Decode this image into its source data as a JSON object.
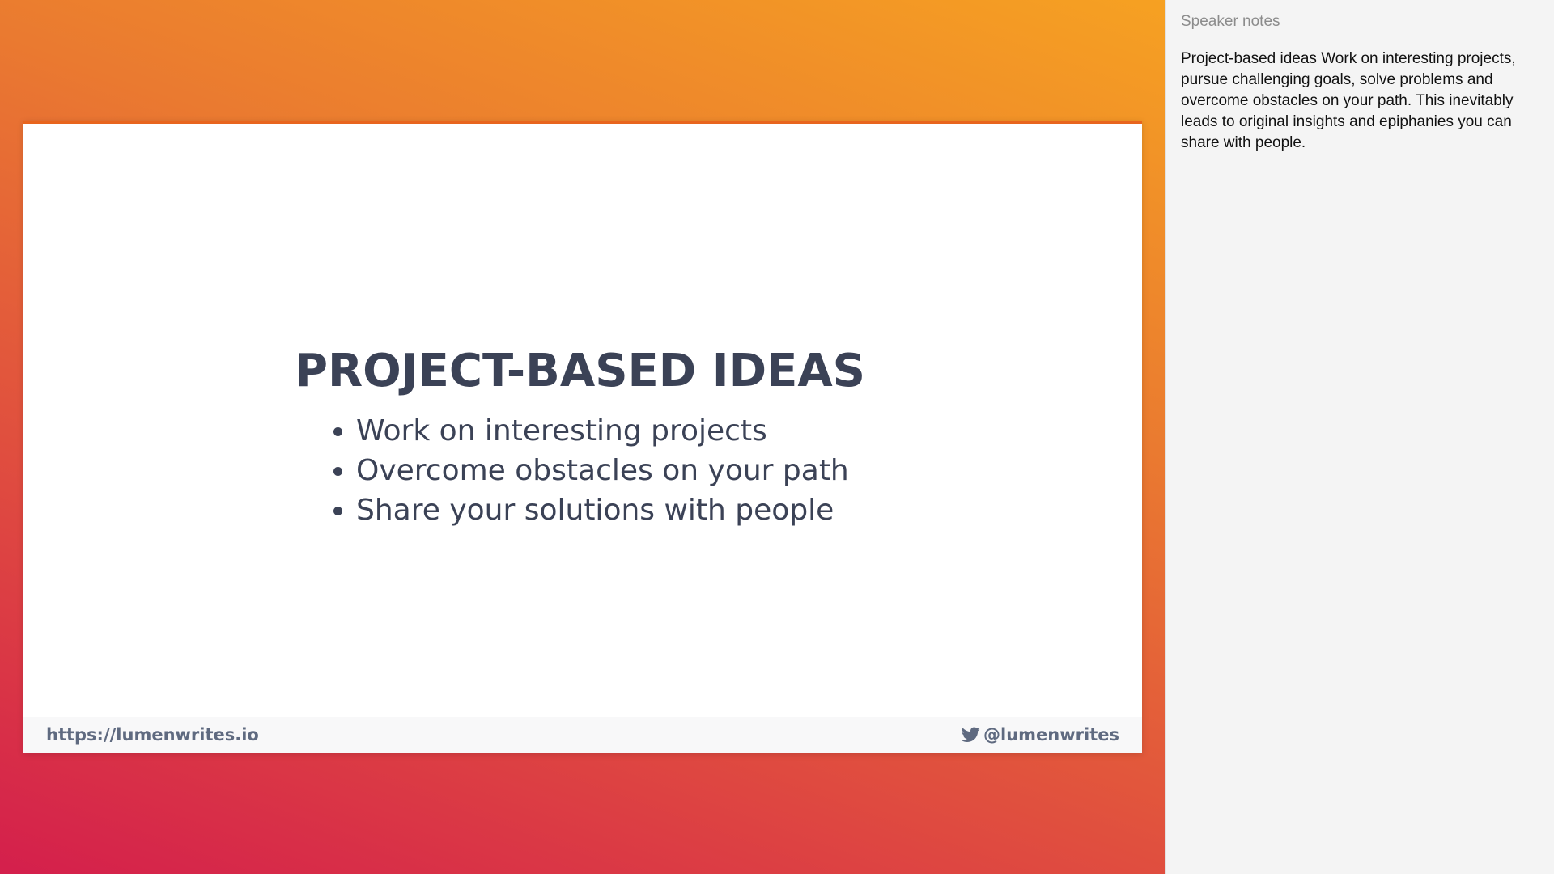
{
  "slide": {
    "title": "PROJECT-BASED IDEAS",
    "bullets": [
      "Work on interesting projects",
      "Overcome obstacles on your path",
      "Share your solutions with people"
    ],
    "footer": {
      "url": "https://lumenwrites.io",
      "handle": "@lumenwrites",
      "handle_icon": "twitter-icon"
    }
  },
  "notes": {
    "title": "Speaker notes",
    "body": "Project-based ideas Work on interesting projects, pursue challenging goals, solve problems and overcome obstacles on your path. This inevitably leads to original insights and epiphanies you can share with people."
  },
  "colors": {
    "gradient_start": "#f6a122",
    "gradient_end": "#d41f4c",
    "slide_accent": "#e8651e",
    "text_dark": "#3b4256",
    "footer_text": "#5f6a80",
    "notes_bg": "#f4f4f4"
  }
}
